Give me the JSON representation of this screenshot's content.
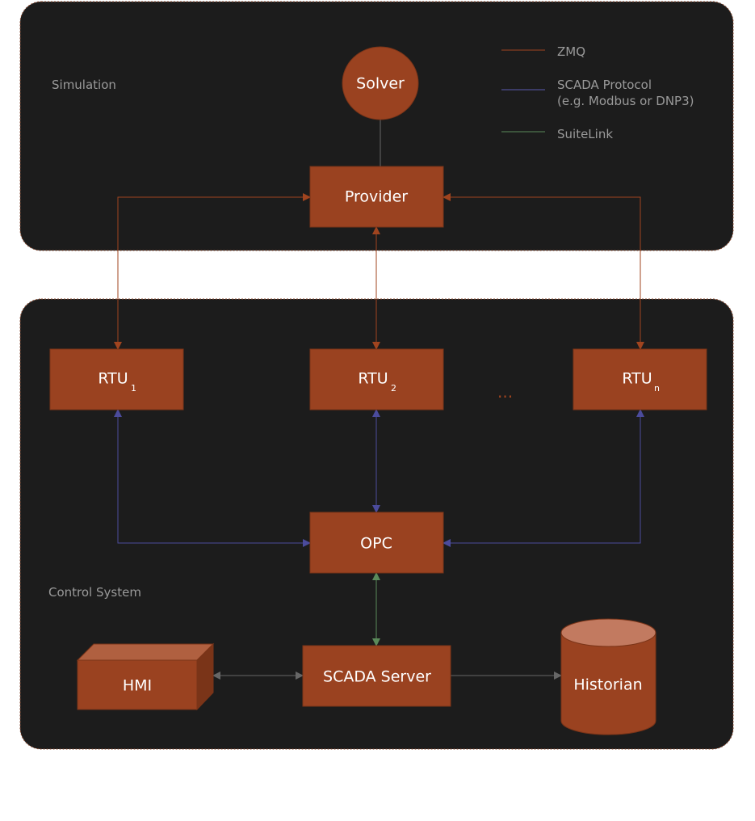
{
  "colors": {
    "panel": "#1c1c1c",
    "node": "#9a4220",
    "zmq": "#a0441f",
    "scada": "#4b4b9c",
    "suitelink": "#5a8a5a",
    "local": "#666666"
  },
  "panels": {
    "simulation": "Simulation",
    "control": "Control System"
  },
  "legend": [
    {
      "label": "ZMQ",
      "sub": ""
    },
    {
      "label": "SCADA Protocol",
      "sub": "(e.g. Modbus or DNP3)"
    },
    {
      "label": "SuiteLink",
      "sub": ""
    }
  ],
  "nodes": {
    "solver": "Solver",
    "provider": "Provider",
    "rtu1": "RTU",
    "rtu1_sub": "1",
    "rtu2": "RTU",
    "rtu2_sub": "2",
    "rtun": "RTU",
    "rtun_sub": "n",
    "ellipsis": "...",
    "opc": "OPC",
    "hmi": "HMI",
    "scada_server": "SCADA Server",
    "historian": "Historian"
  }
}
